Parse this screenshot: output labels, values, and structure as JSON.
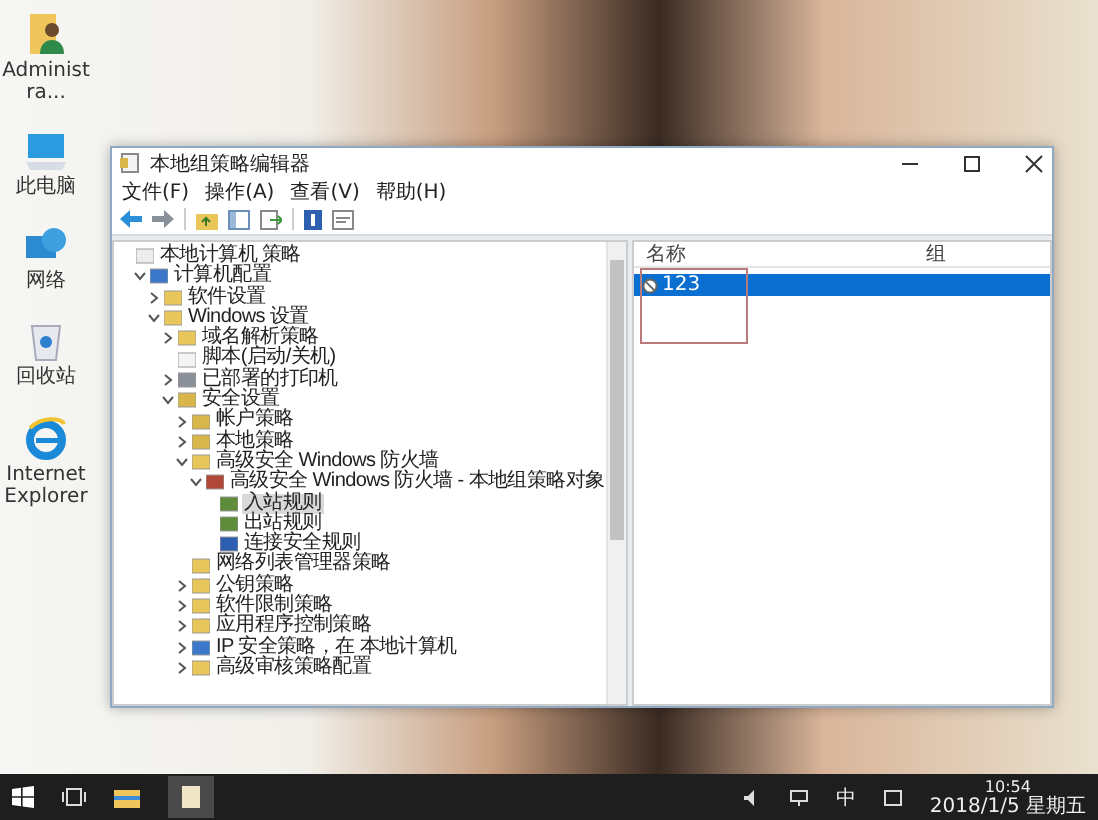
{
  "desktop_icons": [
    {
      "label": "Administra...",
      "kind": "user"
    },
    {
      "label": "此电脑",
      "kind": "computer"
    },
    {
      "label": "网络",
      "kind": "network"
    },
    {
      "label": "回收站",
      "kind": "recycle"
    },
    {
      "label": "Internet Explorer",
      "kind": "ie"
    }
  ],
  "window": {
    "title": "本地组策略编辑器",
    "menu": [
      "文件(F)",
      "操作(A)",
      "查看(V)",
      "帮助(H)"
    ]
  },
  "tree": [
    {
      "label": "本地计算机 策略",
      "kind": "policy",
      "selected": false,
      "children": [
        {
          "label": "计算机配置",
          "kind": "computer",
          "expanded": true,
          "selected": false,
          "children": [
            {
              "label": "软件设置",
              "kind": "folder",
              "expanded": false,
              "selected": false
            },
            {
              "label": "Windows 设置",
              "kind": "folder",
              "expanded": true,
              "selected": false,
              "children": [
                {
                  "label": "域名解析策略",
                  "kind": "folder",
                  "expanded": false,
                  "selected": false
                },
                {
                  "label": "脚本(启动/关机)",
                  "kind": "document",
                  "selected": false
                },
                {
                  "label": "已部署的打印机",
                  "kind": "printer",
                  "expanded": false,
                  "selected": false
                },
                {
                  "label": "安全设置",
                  "kind": "security",
                  "expanded": true,
                  "selected": false,
                  "children": [
                    {
                      "label": "帐户策略",
                      "kind": "security",
                      "expanded": false,
                      "selected": false
                    },
                    {
                      "label": "本地策略",
                      "kind": "security",
                      "expanded": false,
                      "selected": false
                    },
                    {
                      "label": "高级安全 Windows 防火墙",
                      "kind": "folder",
                      "expanded": true,
                      "selected": false,
                      "children": [
                        {
                          "label": "高级安全 Windows 防火墙 - 本地组策略对象",
                          "kind": "firewall",
                          "expanded": true,
                          "selected": false,
                          "children": [
                            {
                              "label": "入站规则",
                              "kind": "rule",
                              "selected": true
                            },
                            {
                              "label": "出站规则",
                              "kind": "rule",
                              "selected": false
                            },
                            {
                              "label": "连接安全规则",
                              "kind": "link",
                              "selected": false
                            }
                          ]
                        }
                      ]
                    },
                    {
                      "label": "网络列表管理器策略",
                      "kind": "folder",
                      "selected": false
                    },
                    {
                      "label": "公钥策略",
                      "kind": "folder",
                      "expanded": false,
                      "selected": false
                    },
                    {
                      "label": "软件限制策略",
                      "kind": "folder",
                      "expanded": false,
                      "selected": false
                    },
                    {
                      "label": "应用程序控制策略",
                      "kind": "folder",
                      "expanded": false,
                      "selected": false
                    },
                    {
                      "label": "IP 安全策略，在 本地计算机",
                      "kind": "computer",
                      "expanded": false,
                      "selected": false
                    },
                    {
                      "label": "高级审核策略配置",
                      "kind": "folder",
                      "expanded": false,
                      "selected": false
                    }
                  ]
                }
              ]
            }
          ]
        }
      ]
    }
  ],
  "list": {
    "columns": [
      "名称",
      "组"
    ],
    "rows": [
      {
        "cells": [
          "123"
        ],
        "selected": true
      }
    ]
  },
  "taskbar": {
    "ime": "中",
    "time": "10:54",
    "date": "2018/1/5 星期五"
  }
}
